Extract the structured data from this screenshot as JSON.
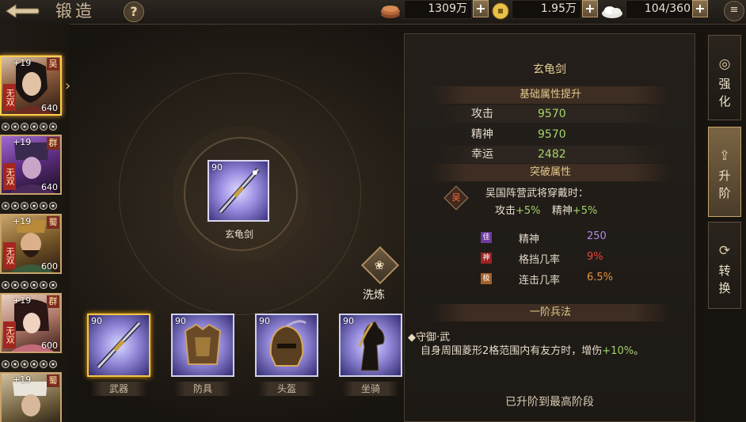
{
  "header": {
    "title": "锻造",
    "help": "?",
    "resources": [
      {
        "icon": "coins-icon",
        "value": "1309万"
      },
      {
        "icon": "gold-ingot-icon",
        "value": "1.95万"
      },
      {
        "icon": "stamina-icon",
        "value": "104/360"
      }
    ],
    "menu": "≡"
  },
  "heroes": [
    {
      "level": "+19",
      "faction": "吴",
      "tag": "无双",
      "power": "640",
      "selected": true
    },
    {
      "level": "+19",
      "faction": "群",
      "tag": "无双",
      "power": "640",
      "selected": false
    },
    {
      "level": "+19",
      "faction": "蜀",
      "tag": "无双",
      "power": "600",
      "selected": false
    },
    {
      "level": "+19",
      "faction": "群",
      "tag": "无双",
      "power": "600",
      "selected": false
    },
    {
      "level": "+19",
      "faction": "蜀",
      "tag": "",
      "power": "",
      "selected": false
    }
  ],
  "main_item": {
    "level": "90",
    "name": "玄龟剑"
  },
  "refine": {
    "label": "洗炼"
  },
  "slots": [
    {
      "level": "90",
      "label": "武器",
      "selected": true
    },
    {
      "level": "90",
      "label": "防具",
      "selected": false
    },
    {
      "level": "90",
      "label": "头盔",
      "selected": false
    },
    {
      "level": "90",
      "label": "坐骑",
      "selected": false
    }
  ],
  "panel": {
    "title": "玄龟剑",
    "base_header": "基础属性提升",
    "stats": [
      {
        "name": "攻击",
        "value": "9570"
      },
      {
        "name": "精神",
        "value": "9570"
      },
      {
        "name": "幸运",
        "value": "2482"
      }
    ],
    "break_header": "突破属性",
    "break_badge": "吴",
    "break_condition": "吴国阵营武将穿戴时：",
    "break_bonus_a_name": "攻击",
    "break_bonus_a_val": "+5%",
    "break_bonus_b_name": "精神",
    "break_bonus_b_val": "+5%",
    "traits": [
      {
        "badge": "佳",
        "name": "精神",
        "value": "250",
        "color": "#b18ae6",
        "badge_color": "#6d3b9e"
      },
      {
        "badge": "神",
        "name": "格挡几率",
        "value": "9%",
        "color": "#e4473a",
        "badge_color": "#9c2422"
      },
      {
        "badge": "极",
        "name": "连击几率",
        "value": "6.5%",
        "color": "#e8913a",
        "badge_color": "#a3612a"
      }
    ],
    "skill_header": "一阶兵法",
    "skill_name": "◆守御·武",
    "skill_desc": "自身周围菱形2格范围内有友方时，增伤",
    "skill_desc_bonus": "+10%",
    "skill_desc_end": "。",
    "maxed_text": "已升阶到最高阶段"
  },
  "tabs": [
    {
      "icon": "enhance-icon",
      "label": "强化",
      "active": false
    },
    {
      "icon": "upgrade-icon",
      "label": "升阶",
      "active": true
    },
    {
      "icon": "convert-icon",
      "label": "转换",
      "active": false
    }
  ]
}
